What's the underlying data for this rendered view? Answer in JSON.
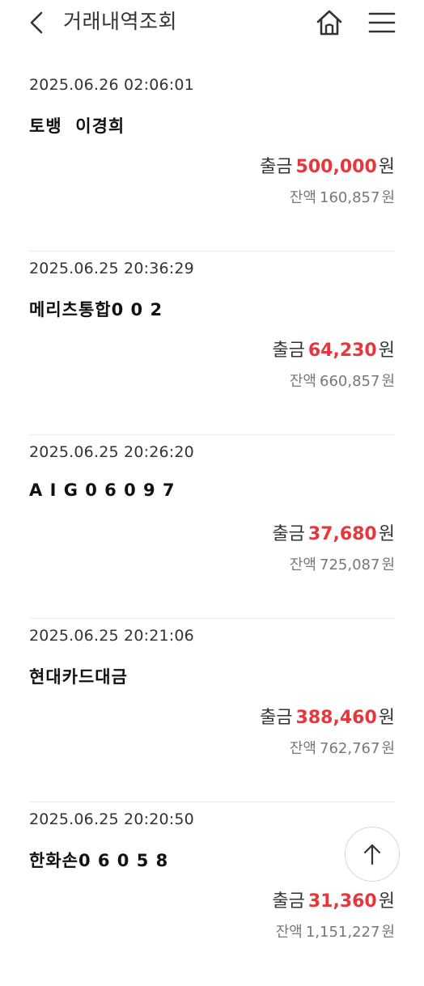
{
  "header": {
    "title": "거래내역조회",
    "back_icon": "chevron-left-icon",
    "home_icon": "home-icon",
    "menu_icon": "hamburger-menu-icon"
  },
  "colors": {
    "amount_red": "#e8363a",
    "text_dark": "#222222",
    "text_gray": "#777777",
    "divider": "#ececec"
  },
  "transactions": [
    {
      "datetime": "2025.06.26 02:06:01",
      "name": "토뱅  이경희",
      "type_label": "출금",
      "amount": "500,000",
      "currency": "원",
      "balance_label": "잔액",
      "balance": "160,857",
      "balance_currency": "원"
    },
    {
      "datetime": "2025.06.25 20:36:29",
      "name": "메리츠통합0 0 2",
      "type_label": "출금",
      "amount": "64,230",
      "currency": "원",
      "balance_label": "잔액",
      "balance": "660,857",
      "balance_currency": "원"
    },
    {
      "datetime": "2025.06.25 20:26:20",
      "name": "A I G 0 6 0 9 7",
      "type_label": "출금",
      "amount": "37,680",
      "currency": "원",
      "balance_label": "잔액",
      "balance": "725,087",
      "balance_currency": "원"
    },
    {
      "datetime": "2025.06.25 20:21:06",
      "name": "현대카드대금",
      "type_label": "출금",
      "amount": "388,460",
      "currency": "원",
      "balance_label": "잔액",
      "balance": "762,767",
      "balance_currency": "원"
    },
    {
      "datetime": "2025.06.25 20:20:50",
      "name": "한화손0 6 0 5 8",
      "type_label": "출금",
      "amount": "31,360",
      "currency": "원",
      "balance_label": "잔액",
      "balance": "1,151,227",
      "balance_currency": "원"
    }
  ],
  "scroll_top_icon": "arrow-up-icon"
}
